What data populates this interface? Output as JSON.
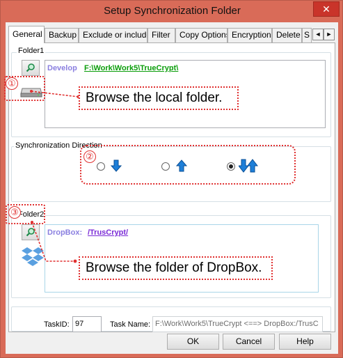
{
  "window": {
    "title": "Setup Synchronization Folder",
    "close_glyph": "✕"
  },
  "tabs": [
    "General",
    "Backup",
    "Exclude or include",
    "Filter",
    "Copy Options",
    "Encryption",
    "Delete",
    "S"
  ],
  "tab_scroll": {
    "left": "◄",
    "right": "►"
  },
  "folder1": {
    "label": "Folder1",
    "prefix": "Develop",
    "path": "F:\\Work\\Work5\\TrueCrypt\\",
    "browse_icon": "search-icon",
    "drive_icon": "drive-icon"
  },
  "direction": {
    "label": "Synchronization Direction",
    "options": [
      "down-arrow",
      "up-arrow",
      "both-arrows"
    ],
    "selected": "both-arrows"
  },
  "folder2": {
    "label": "Folder2",
    "prefix": "DropBox:",
    "path": "/TrusCrypt/",
    "browse_icon": "search-icon",
    "dropbox_icon": "dropbox-icon"
  },
  "callouts": {
    "n1": "①",
    "n2": "②",
    "n3": "③",
    "text1": "Browse the local folder.",
    "text3": "Browse the folder of DropBox."
  },
  "task": {
    "id_label": "TaskID:",
    "id_value": "97",
    "name_label": "Task Name:",
    "name_value": "F:\\Work\\Work5\\TrueCrypt <==> DropBox:/TrusC"
  },
  "buttons": {
    "ok": "OK",
    "cancel": "Cancel",
    "help": "Help"
  },
  "colors": {
    "accent_red": "#e03030",
    "arrow_blue": "#1e7fd8",
    "path_green": "#0a9d0a",
    "prefix_purple": "#8a7fe0"
  }
}
